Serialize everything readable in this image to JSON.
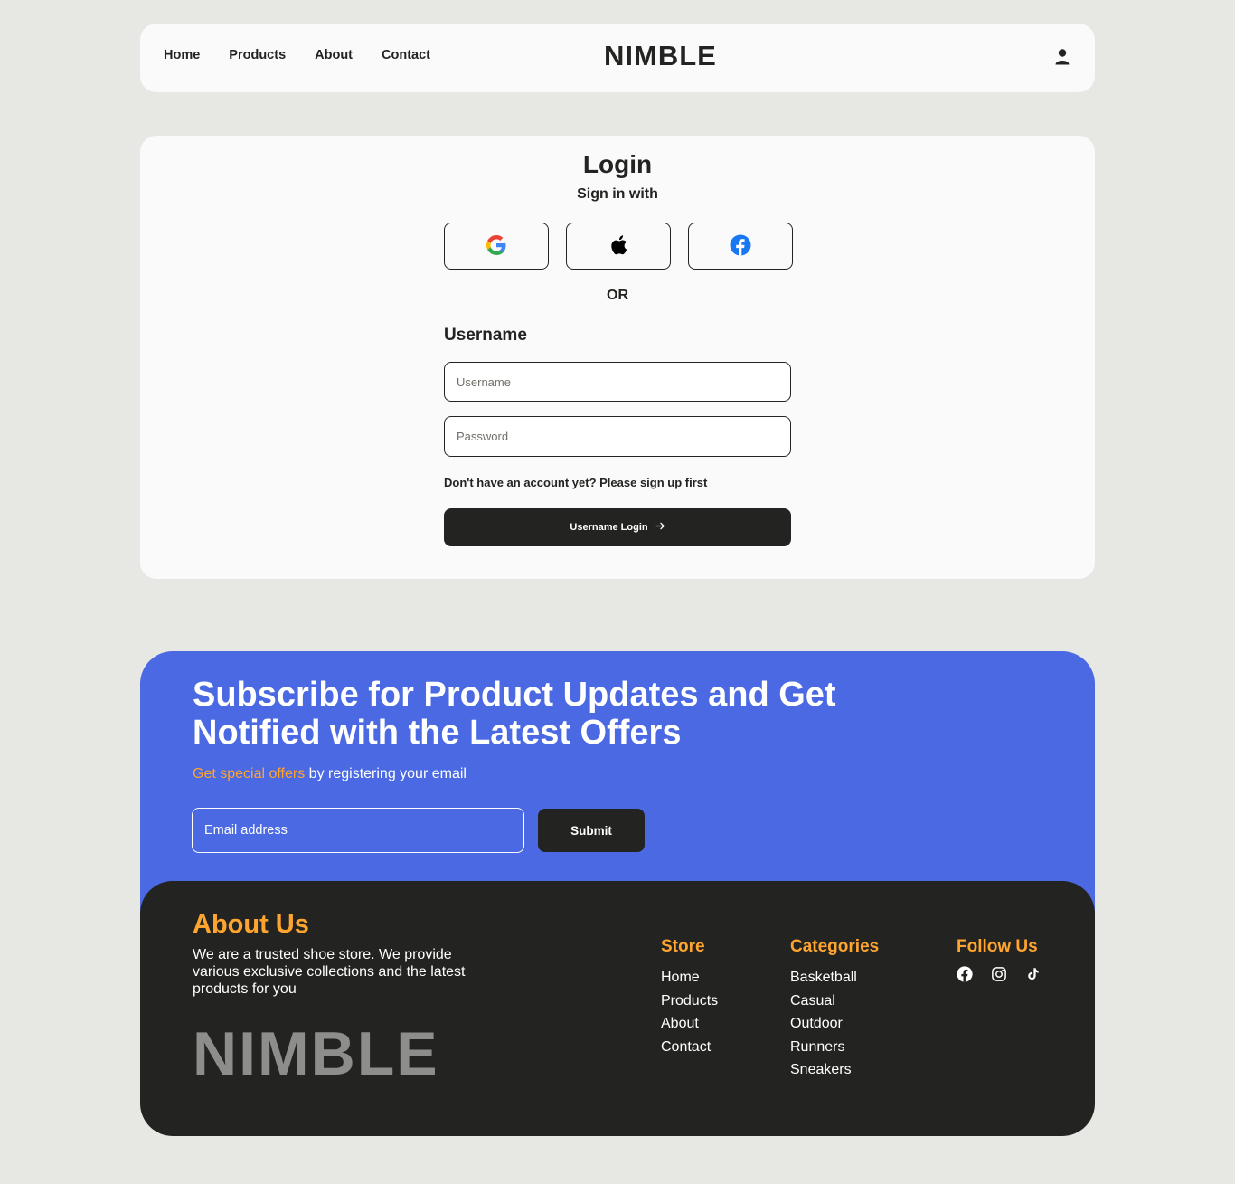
{
  "nav": {
    "links": [
      "Home",
      "Products",
      "About",
      "Contact"
    ],
    "brand": "NIMBLE",
    "user_icon": "user-icon"
  },
  "login": {
    "title": "Login",
    "subtitle": "Sign in with",
    "social": [
      "google-icon",
      "apple-icon",
      "facebook-icon"
    ],
    "or_text": "OR",
    "username_heading": "Username",
    "username_placeholder": "Username",
    "password_placeholder": "Password",
    "signup_text": "Don't have an account yet? Please sign up first",
    "login_button": "Username Login",
    "login_icon": "arrow-right-icon"
  },
  "subscribe": {
    "title": "Subscribe for Product Updates and Get Notified with the Latest Offers",
    "sub_accent": "Get special offers",
    "sub_rest": " by registering your email",
    "email_placeholder": "Email address",
    "submit": "Submit"
  },
  "footer": {
    "about_title": "About Us",
    "about_text": "We are a trusted shoe store. We provide various exclusive collections and the latest products for you",
    "brand": "NIMBLE",
    "store": {
      "title": "Store",
      "items": [
        "Home",
        "Products",
        "About",
        "Contact"
      ]
    },
    "categories": {
      "title": "Categories",
      "items": [
        "Basketball",
        "Casual",
        "Outdoor",
        "Runners",
        "Sneakers"
      ]
    },
    "follow": {
      "title": "Follow Us",
      "icons": [
        "facebook-icon",
        "instagram-icon",
        "tiktok-icon"
      ]
    }
  },
  "colors": {
    "background": "#e7e7e3",
    "dark": "#232321",
    "blue": "#4a69e2",
    "orange": "#ffa52f"
  }
}
